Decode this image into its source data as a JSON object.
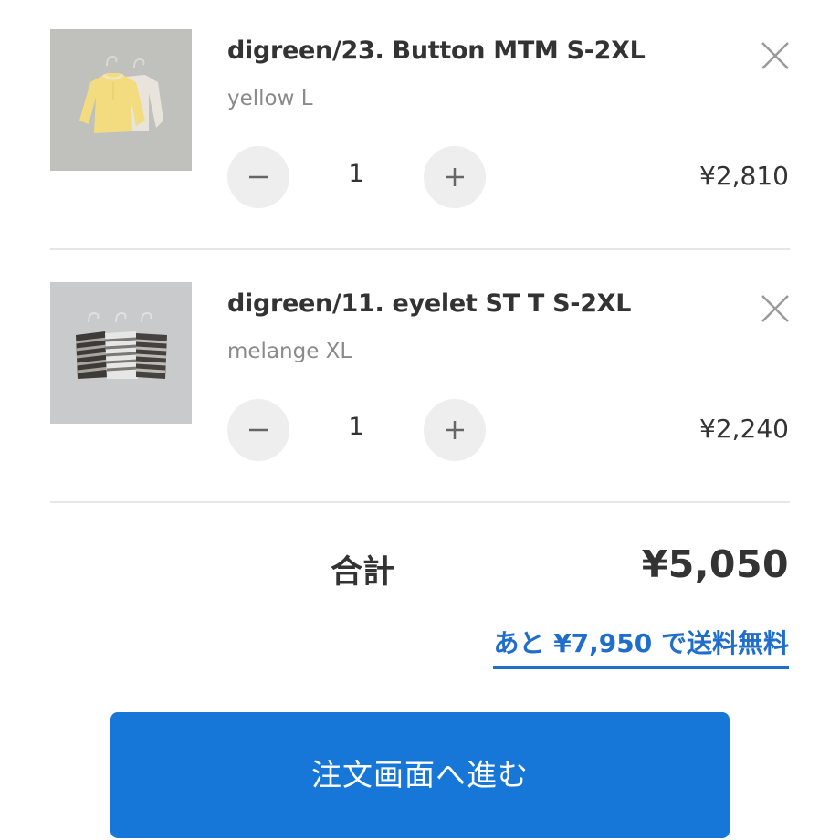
{
  "cart": {
    "items": [
      {
        "image_alt": "yellow and cream sweatshirts on hangers",
        "name": "digreen/23. Button MTM S-2XL",
        "variant": "yellow L",
        "quantity": "1",
        "price": "¥2,810",
        "minus_icon": "minus-icon",
        "plus_icon": "plus-icon",
        "remove_icon": "close-icon"
      },
      {
        "image_alt": "striped long-sleeve tees on hangers",
        "name": "digreen/11. eyelet ST T S-2XL",
        "variant": "melange XL",
        "quantity": "1",
        "price": "¥2,240",
        "minus_icon": "minus-icon",
        "plus_icon": "plus-icon",
        "remove_icon": "close-icon"
      }
    ]
  },
  "summary": {
    "total_label": "合計",
    "total_value": "¥5,050",
    "shipping_note": "あと ¥7,950 で送料無料"
  },
  "checkout": {
    "button_label": "注文画面へ進む"
  },
  "colors": {
    "accent": "#1677d8",
    "link": "#1f6ecb",
    "qty_button_bg": "#eeeeee",
    "divider": "#e6e6e6"
  }
}
